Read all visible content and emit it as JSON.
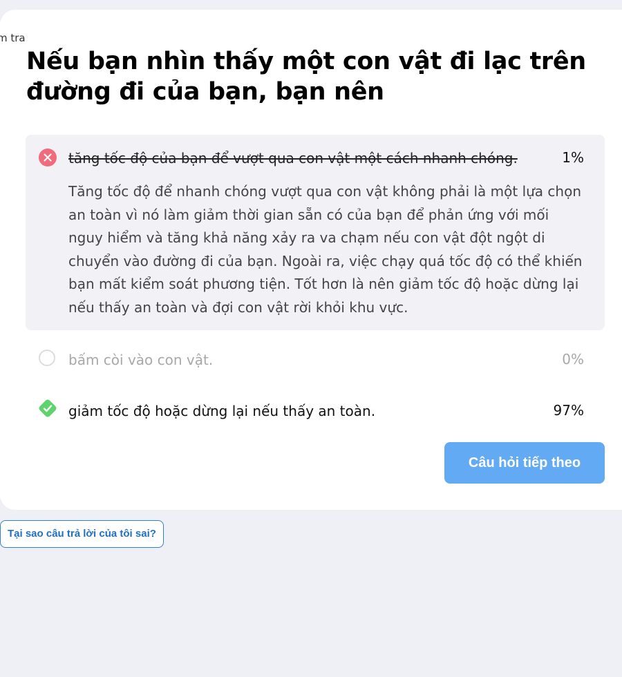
{
  "breadcrumb": "m tra",
  "question": "Nếu bạn nhìn thấy một con vật đi lạc trên đường đi của bạn, bạn nên",
  "options": [
    {
      "text": "tăng tốc độ của bạn để vượt qua con vật một cách nhanh chóng.",
      "percent": "1%",
      "status": "wrong",
      "explanation": "Tăng tốc độ để nhanh chóng vượt qua con vật không phải là một lựa chọn an toàn vì nó làm giảm thời gian sẵn có của bạn để phản ứng với mối nguy hiểm và tăng khả năng xảy ra va chạm nếu con vật đột ngột di chuyển vào đường đi của bạn. Ngoài ra, việc chạy quá tốc độ có thể khiến bạn mất kiểm soát phương tiện. Tốt hơn là nên giảm tốc độ hoặc dừng lại nếu thấy an toàn và đợi con vật rời khỏi khu vực."
    },
    {
      "text": "bấm còi vào con vật.",
      "percent": "0%",
      "status": "neutral"
    },
    {
      "text": "giảm tốc độ hoặc dừng lại nếu thấy an toàn.",
      "percent": "97%",
      "status": "correct"
    }
  ],
  "buttons": {
    "next": "Câu hỏi tiếp theo",
    "why_wrong": "Tại sao câu trả lời của tôi sai?"
  },
  "colors": {
    "background": "#eef0f5",
    "wrong": "#f06b7c",
    "correct": "#5fd36d",
    "primary": "#63aaf5",
    "link": "#1f6fc8"
  }
}
